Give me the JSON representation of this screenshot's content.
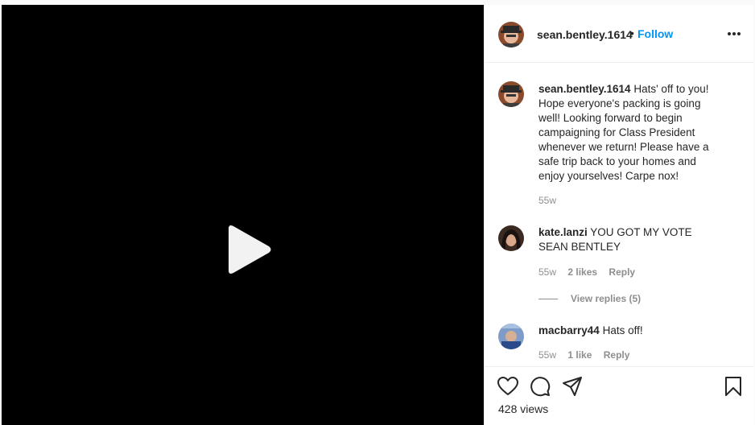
{
  "post": {
    "username": "sean.bentley.1614",
    "separator": "•",
    "follow_label": "Follow"
  },
  "comments": [
    {
      "username": "sean.bentley.1614",
      "text": "Hats' off to you! Hope everyone's packing is going well! Looking forward to begin campaigning for Class President whenever we return! Please have a safe trip back to your homes and enjoy yourselves! Carpe nox!",
      "time": "55w"
    },
    {
      "username": "kate.lanzi",
      "text": "YOU GOT MY VOTE SEAN BENTLEY",
      "time": "55w",
      "likes": "2 likes",
      "reply_label": "Reply",
      "view_replies": "View replies (5)"
    },
    {
      "username": "macbarry44",
      "text": "Hats off!",
      "time": "55w",
      "likes": "1 like",
      "reply_label": "Reply"
    }
  ],
  "stats": {
    "views": "428 views"
  },
  "icons": [
    "play-icon",
    "more-options-icon",
    "heart-icon",
    "comment-icon",
    "share-icon",
    "bookmark-icon"
  ],
  "colors": {
    "video_bg": "#000000",
    "link": "#0095f6",
    "meta": "#8e8e8e"
  }
}
